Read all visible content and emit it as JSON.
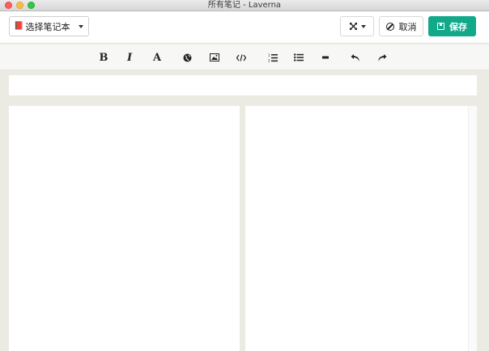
{
  "window": {
    "title": "所有笔记 - Laverna"
  },
  "header": {
    "notebook_select": {
      "label": "选择笔记本",
      "icon": "book-icon"
    },
    "fullscreen": {
      "icon": "expand-icon"
    },
    "cancel": {
      "label": "取消",
      "icon": "ban-icon"
    },
    "save": {
      "label": "保存",
      "icon": "floppy-icon",
      "color": "#12a88a"
    }
  },
  "toolbar": {
    "bold": "B",
    "italic": "I",
    "font": "A",
    "items": [
      "bold-icon",
      "italic-icon",
      "heading-icon",
      "globe-link-icon",
      "image-icon",
      "code-icon",
      "ordered-list-icon",
      "unordered-list-icon",
      "horizontal-rule-icon",
      "undo-icon",
      "redo-icon"
    ]
  },
  "colors": {
    "background": "#ecebe3",
    "accent": "#12a88a"
  }
}
